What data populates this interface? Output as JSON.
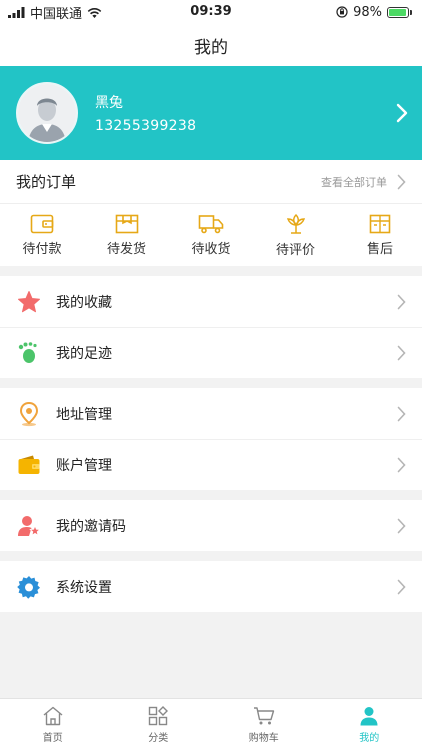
{
  "status_bar": {
    "carrier": "中国联通",
    "time": "09:39",
    "battery": "98%"
  },
  "nav": {
    "title": "我的"
  },
  "profile": {
    "name": "黑兔",
    "phone": "13255399238"
  },
  "orders": {
    "title": "我的订单",
    "view_all": "查看全部订单",
    "items": [
      {
        "label": "待付款",
        "icon": "wallet-icon"
      },
      {
        "label": "待发货",
        "icon": "package-icon"
      },
      {
        "label": "待收货",
        "icon": "truck-icon"
      },
      {
        "label": "待评价",
        "icon": "review-icon"
      },
      {
        "label": "售后",
        "icon": "after-sale-icon"
      }
    ]
  },
  "menu": {
    "favorites": "我的收藏",
    "footprints": "我的足迹",
    "address": "地址管理",
    "account": "账户管理",
    "invite": "我的邀请码",
    "settings": "系统设置"
  },
  "tabbar": {
    "home": "首页",
    "category": "分类",
    "cart": "购物车",
    "mine": "我的"
  },
  "colors": {
    "accent": "#22c4c6",
    "order_icon": "#e6a817",
    "star": "#f26b6b",
    "footprint": "#4cc46a",
    "location": "#f0a33c",
    "wallet": "#f5b400",
    "invite": "#f26b6b",
    "gear": "#2a8fd8"
  }
}
